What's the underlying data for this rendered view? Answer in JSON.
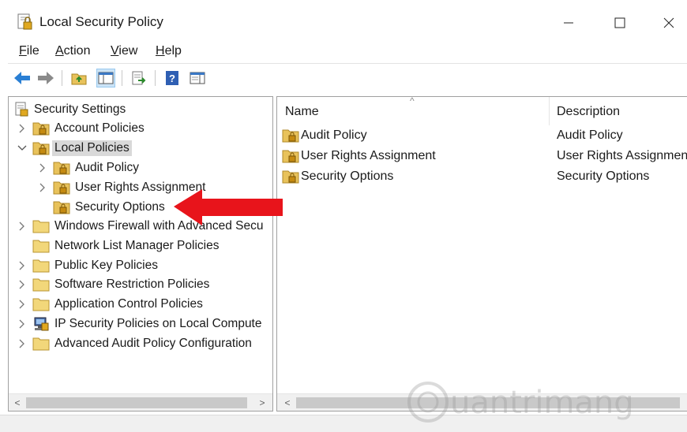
{
  "window": {
    "title": "Local Security Policy",
    "controls": {
      "minimize": "─",
      "maximize": "☐",
      "close": "✕"
    }
  },
  "menu": {
    "items": [
      {
        "accel": "F",
        "rest": "ile"
      },
      {
        "accel": "A",
        "rest": "ction"
      },
      {
        "accel": "V",
        "rest": "iew"
      },
      {
        "accel": "H",
        "rest": "elp"
      }
    ]
  },
  "toolbar": {
    "buttons": [
      "back-icon",
      "forward-icon",
      "up-folder-icon",
      "show-hide-tree-icon",
      "export-list-icon",
      "help-icon",
      "properties-pane-icon"
    ]
  },
  "tree": {
    "root": "Security Settings",
    "items": [
      {
        "label": "Account Policies",
        "expander": ">"
      },
      {
        "label": "Local Policies",
        "expander": "v"
      },
      {
        "label": "Audit Policy",
        "expander": ">"
      },
      {
        "label": "User Rights Assignment",
        "expander": ">"
      },
      {
        "label": "Security Options",
        "expander": ""
      },
      {
        "label": "Windows Firewall with Advanced Secu",
        "expander": ">"
      },
      {
        "label": "Network List Manager Policies",
        "expander": ""
      },
      {
        "label": "Public Key Policies",
        "expander": ">"
      },
      {
        "label": "Software Restriction Policies",
        "expander": ">"
      },
      {
        "label": "Application Control Policies",
        "expander": ">"
      },
      {
        "label": "IP Security Policies on Local Compute",
        "expander": ">"
      },
      {
        "label": "Advanced Audit Policy Configuration",
        "expander": ">"
      }
    ]
  },
  "list": {
    "columns": {
      "name": "Name",
      "description": "Description",
      "sort_glyph": "^"
    },
    "rows": [
      {
        "name": "Audit Policy",
        "description": "Audit Policy"
      },
      {
        "name": "User Rights Assignment",
        "description": "User Rights Assignment"
      },
      {
        "name": "Security Options",
        "description": "Security Options"
      }
    ]
  },
  "scroll": {
    "left": "<",
    "right": ">"
  },
  "colors": {
    "annotation_arrow": "#e8141b",
    "folder": "#e8c25b",
    "selection": "#d9d9d9"
  },
  "watermark": {
    "text": "uantrimang"
  }
}
